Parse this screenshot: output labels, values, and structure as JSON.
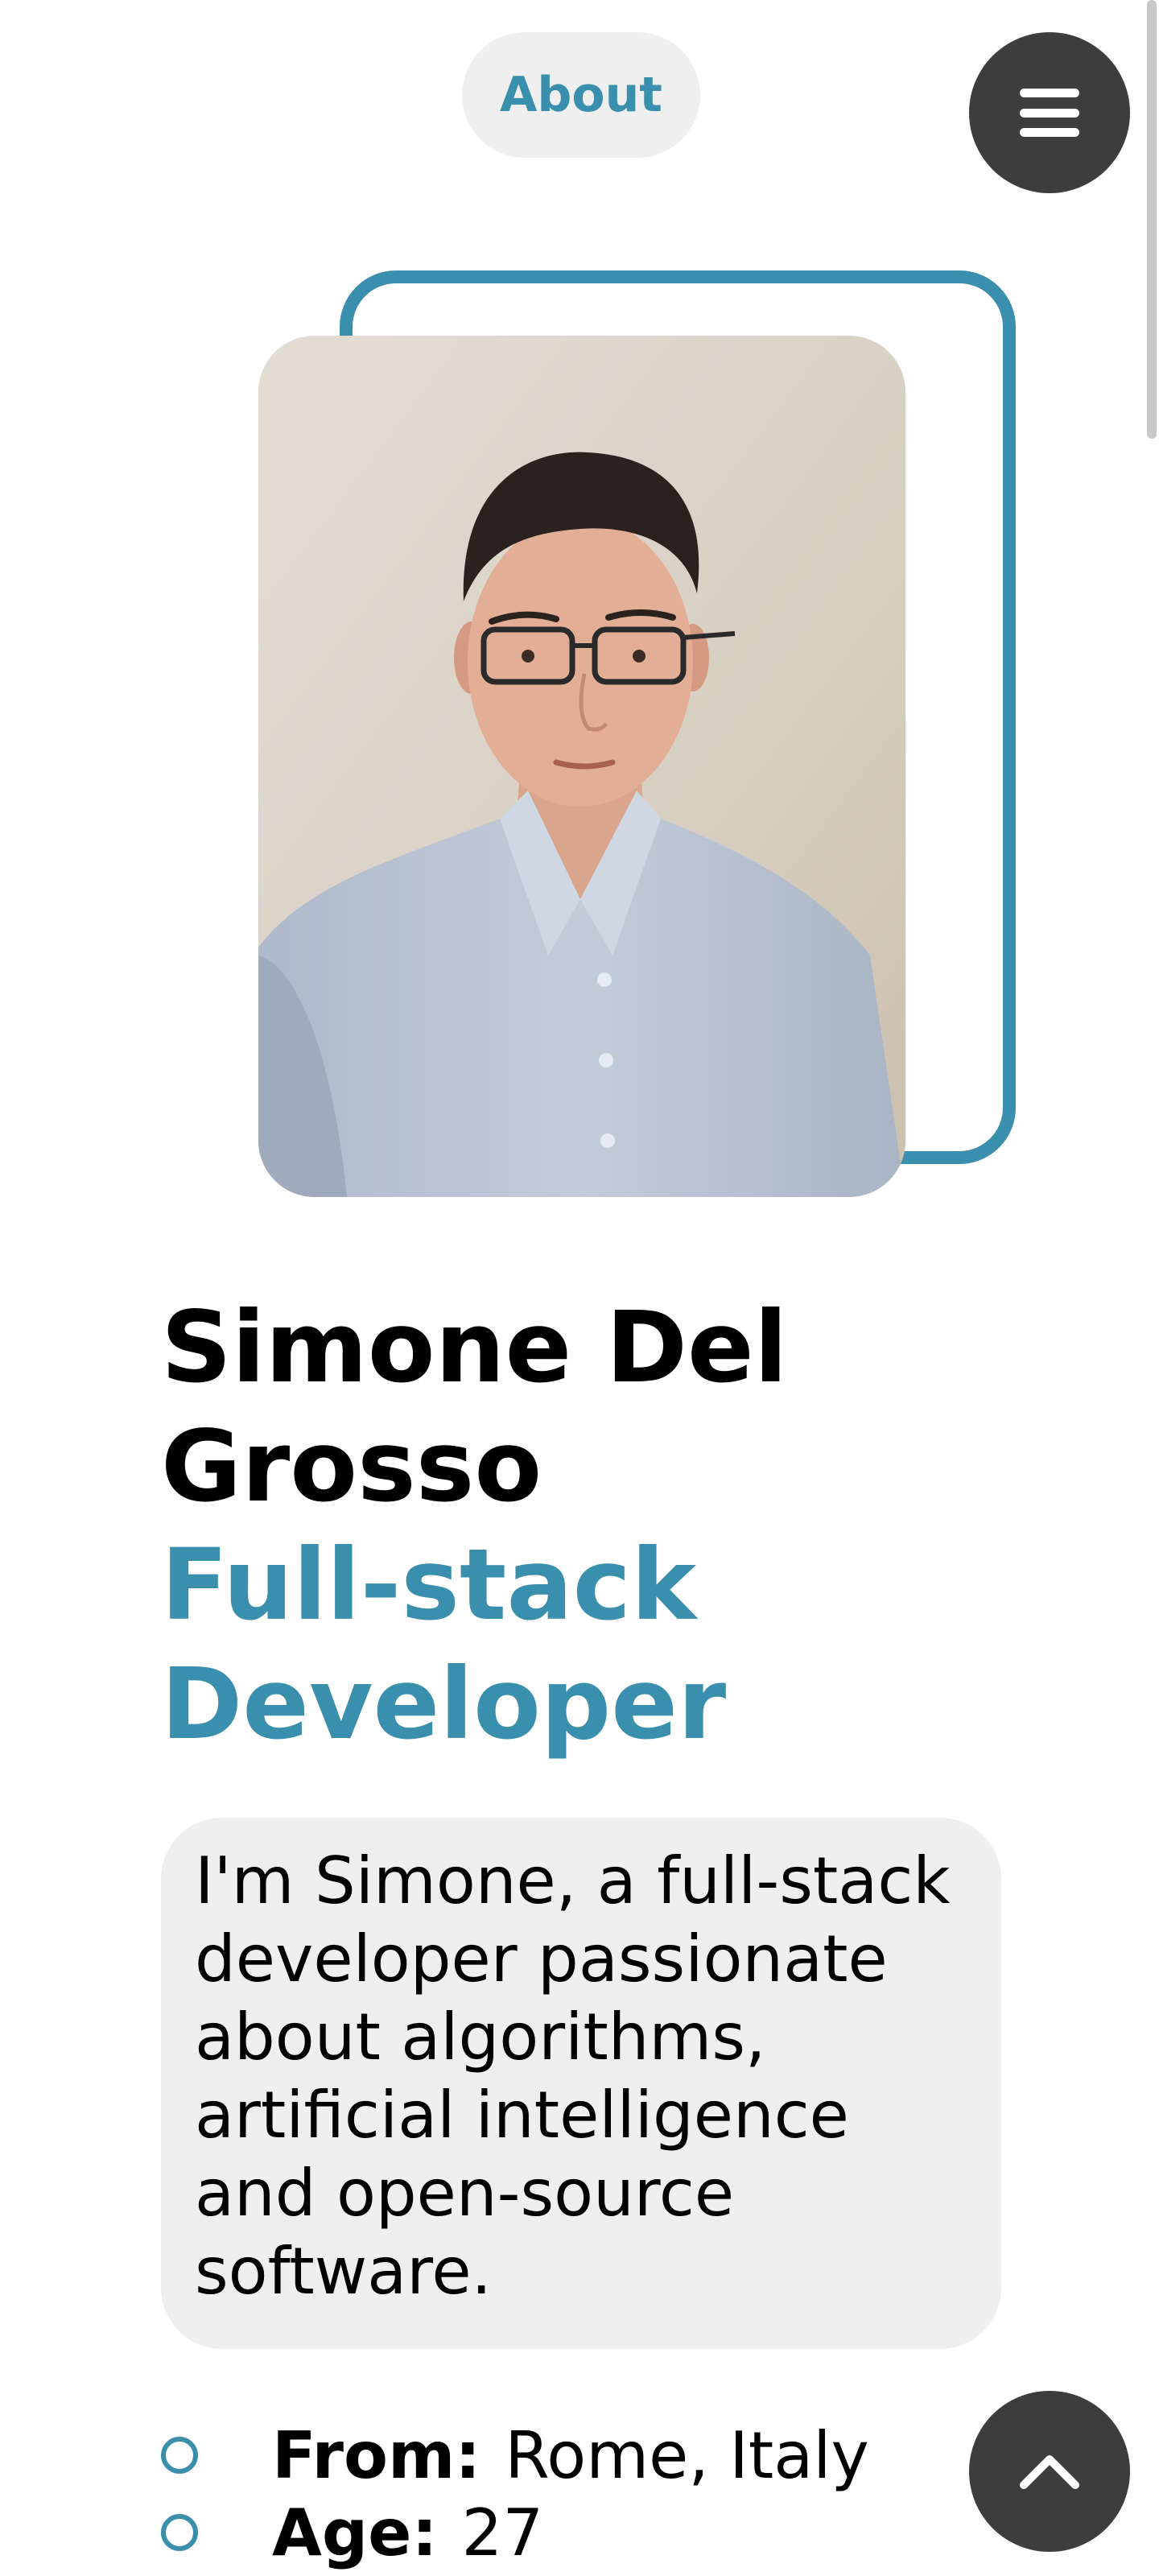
{
  "header": {
    "nav_label": "About",
    "menu_icon": "hamburger-menu-icon"
  },
  "profile": {
    "photo_alt": "Portrait of Simone Del Grosso",
    "name": "Simone Del Grosso",
    "role": "Full-stack Developer",
    "bio": "I'm Simone, a full-stack developer passionate about algorithms, artificial intelligence and open-source software."
  },
  "facts": [
    {
      "label": "From:",
      "value": "Rome, Italy"
    },
    {
      "label": "Age:",
      "value": "27"
    }
  ],
  "scroll_top": {
    "icon": "chevron-up-icon"
  },
  "colors": {
    "accent": "#3a8fad",
    "pill_bg": "#efefef",
    "button_bg": "#3d3d3d",
    "text": "#000000"
  }
}
